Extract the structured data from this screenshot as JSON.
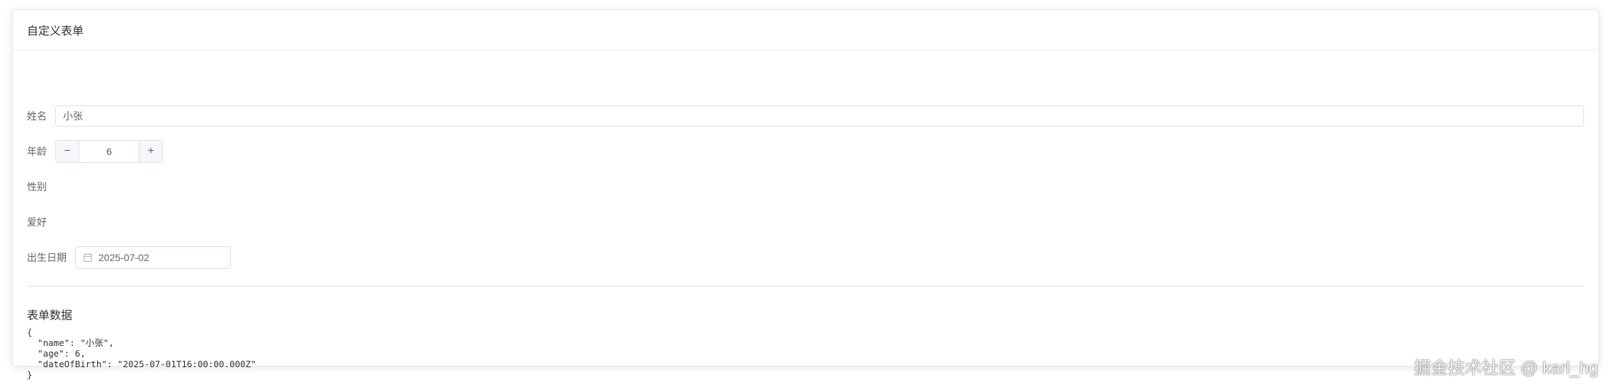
{
  "card": {
    "title": "自定义表单"
  },
  "form": {
    "name": {
      "label": "姓名",
      "value": "小张"
    },
    "age": {
      "label": "年龄",
      "value": "6",
      "decrement": "−",
      "increment": "+"
    },
    "gender": {
      "label": "性别"
    },
    "hobby": {
      "label": "爱好"
    },
    "birth": {
      "label": "出生日期",
      "value": "2025-07-02",
      "icon": "calendar-icon"
    }
  },
  "data_section": {
    "title": "表单数据",
    "json_text": "{\n  \"name\": \"小张\",\n  \"age\": 6,\n  \"dateOfBirth\": \"2025-07-01T16:00:00.000Z\"\n}"
  },
  "watermark": "掘金技术社区 @ karl_hg"
}
